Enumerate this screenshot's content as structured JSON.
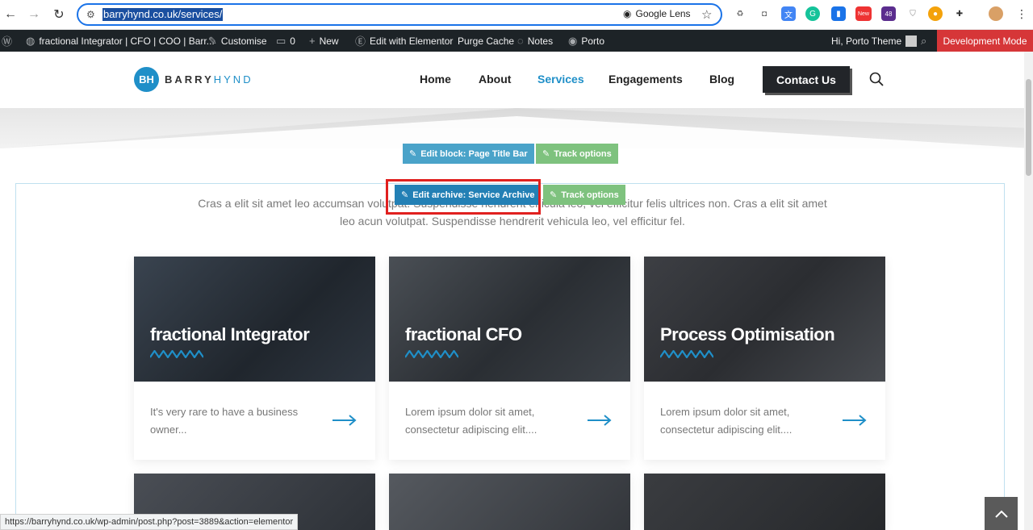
{
  "browser": {
    "url": "barryhynd.co.uk/services/",
    "lens_label": "Google Lens",
    "ext_badges": {
      "new": "New",
      "count": "48"
    }
  },
  "wpbar": {
    "site_title": "fractional Integrator | CFO | COO | Barr...",
    "customise": "Customise",
    "comments": "0",
    "new": "New",
    "elementor": "Edit with Elementor",
    "purge": "Purge Cache",
    "notes": "Notes",
    "theme": "Porto",
    "greeting": "Hi, Porto Theme",
    "dev_mode": "Development Mode"
  },
  "header": {
    "logo_mark": "BH",
    "logo_text_1": "BARRY",
    "logo_text_2": "HYND",
    "menu": [
      "Home",
      "About",
      "Services",
      "Engagements",
      "Blog"
    ],
    "contact": "Contact Us"
  },
  "editor": {
    "edit_block": "Edit block: Page Title Bar",
    "track_options": "Track options",
    "edit_archive": "Edit archive: Service Archive",
    "track_options_2": "Track options"
  },
  "intro_text": "Cras a elit sit amet leo accumsan volutpat. Suspendisse hendrerit ehicula leo, vel efficitur felis ultrices non. Cras a elit sit amet leo acun volutpat. Suspendisse hendrerit vehicula leo, vel efficitur fel.",
  "cards": [
    {
      "title": "fractional Integrator",
      "desc": "It's very rare to have a business owner..."
    },
    {
      "title": "fractional CFO",
      "desc": "Lorem ipsum dolor sit amet, consectetur adipiscing elit...."
    },
    {
      "title": "Process Optimisation",
      "desc": "Lorem ipsum dolor sit amet, consectetur adipiscing elit...."
    }
  ],
  "status_url": "https://barryhynd.co.uk/wp-admin/post.php?post=3889&action=elementor",
  "colors": {
    "accent": "#1f8fc8",
    "wp_bar": "#1d2327",
    "dev_mode": "#d63638",
    "highlight": "#e0201f"
  }
}
